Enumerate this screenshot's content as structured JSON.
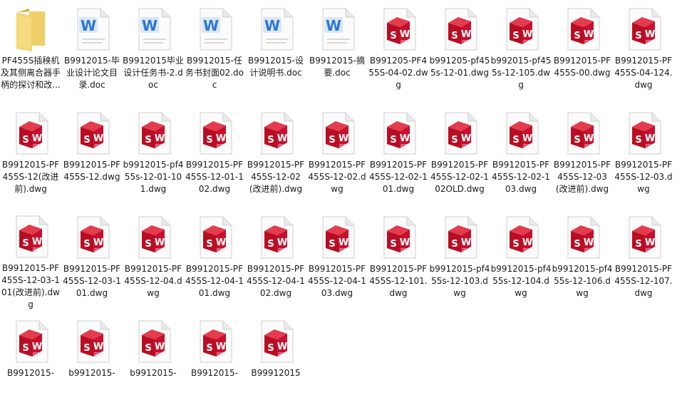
{
  "colors": {
    "folder": "#e8c14f",
    "word_blue": "#2b78d3",
    "sw_red": "#c8102e",
    "doc_page": "#f4f4f4"
  },
  "items": [
    {
      "type": "folder",
      "name": "PF455S插秧机及其侧离合器手柄的探讨和改...",
      "icon": "folder-icon"
    },
    {
      "type": "doc",
      "name": "B9912015-毕业设计论文目录.doc",
      "icon": "word-doc-icon"
    },
    {
      "type": "doc",
      "name": "B9912015毕业设计任务书-2.doc",
      "icon": "word-doc-icon"
    },
    {
      "type": "doc",
      "name": "B9912015-任务书封面02.doc",
      "icon": "word-doc-icon"
    },
    {
      "type": "doc",
      "name": "B9912015-设计说明书.doc",
      "icon": "word-doc-icon"
    },
    {
      "type": "doc",
      "name": "B9912015-摘要.doc",
      "icon": "word-doc-icon"
    },
    {
      "type": "dwg",
      "name": "B991205-PF455S-04-02.dwg",
      "icon": "solidworks-dwg-icon"
    },
    {
      "type": "dwg",
      "name": "b991205-pf455s-12-01.dwg",
      "icon": "solidworks-dwg-icon"
    },
    {
      "type": "dwg",
      "name": "b992015-pf455s-12-105.dwg",
      "icon": "solidworks-dwg-icon"
    },
    {
      "type": "dwg",
      "name": "B9912015-PF455S-00.dwg",
      "icon": "solidworks-dwg-icon"
    },
    {
      "type": "dwg",
      "name": "B9912015-PF455S-04-124.dwg",
      "icon": "solidworks-dwg-icon"
    },
    {
      "type": "dwg",
      "name": "B9912015-PF455S-12(改进前).dwg",
      "icon": "solidworks-dwg-icon"
    },
    {
      "type": "dwg",
      "name": "B9912015-PF455S-12.dwg",
      "icon": "solidworks-dwg-icon"
    },
    {
      "type": "dwg",
      "name": "b9912015-pf455s-12-01-101.dwg",
      "icon": "solidworks-dwg-icon"
    },
    {
      "type": "dwg",
      "name": "B9912015-PF455S-12-01-102.dwg",
      "icon": "solidworks-dwg-icon"
    },
    {
      "type": "dwg",
      "name": "B9912015-PF455S-12-02(改进前).dwg",
      "icon": "solidworks-dwg-icon"
    },
    {
      "type": "dwg",
      "name": "B9912015-PF455S-12-02.dwg",
      "icon": "solidworks-dwg-icon"
    },
    {
      "type": "dwg",
      "name": "B9912015-PF455S-12-02-101.dwg",
      "icon": "solidworks-dwg-icon"
    },
    {
      "type": "dwg",
      "name": "B9912015-PF455S-12-02-102OLD.dwg",
      "icon": "solidworks-dwg-icon"
    },
    {
      "type": "dwg",
      "name": "B9912015-PF455S-12-02-103.dwg",
      "icon": "solidworks-dwg-icon"
    },
    {
      "type": "dwg",
      "name": "B9912015-PF455S-12-03(改进前).dwg",
      "icon": "solidworks-dwg-icon"
    },
    {
      "type": "dwg",
      "name": "B9912015-PF455S-12-03.dwg",
      "icon": "solidworks-dwg-icon"
    },
    {
      "type": "dwg",
      "name": "B9912015-PF455S-12-03-101(改进前).dwg",
      "icon": "solidworks-dwg-icon"
    },
    {
      "type": "dwg",
      "name": "B9912015-PF455S-12-03-101.dwg",
      "icon": "solidworks-dwg-icon"
    },
    {
      "type": "dwg",
      "name": "B9912015-PF455S-12-04.dwg",
      "icon": "solidworks-dwg-icon"
    },
    {
      "type": "dwg",
      "name": "B9912015-PF455S-12-04-101.dwg",
      "icon": "solidworks-dwg-icon"
    },
    {
      "type": "dwg",
      "name": "B9912015-PF455S-12-04-102.dwg",
      "icon": "solidworks-dwg-icon"
    },
    {
      "type": "dwg",
      "name": "B9912015-PF455S-12-04-103.dwg",
      "icon": "solidworks-dwg-icon"
    },
    {
      "type": "dwg",
      "name": "B9912015-PF455S-12-101.dwg",
      "icon": "solidworks-dwg-icon"
    },
    {
      "type": "dwg",
      "name": "b9912015-pf455s-12-103.dwg",
      "icon": "solidworks-dwg-icon"
    },
    {
      "type": "dwg",
      "name": "b9912015-pf455s-12-104.dwg",
      "icon": "solidworks-dwg-icon"
    },
    {
      "type": "dwg",
      "name": "b9912015-pf455s-12-106.dwg",
      "icon": "solidworks-dwg-icon"
    },
    {
      "type": "dwg",
      "name": "B9912015-PF455S-12-107.dwg",
      "icon": "solidworks-dwg-icon"
    },
    {
      "type": "dwg",
      "name": "B9912015-",
      "icon": "solidworks-dwg-icon"
    },
    {
      "type": "dwg",
      "name": "b9912015-",
      "icon": "solidworks-dwg-icon"
    },
    {
      "type": "dwg",
      "name": "b9912015-",
      "icon": "solidworks-dwg-icon"
    },
    {
      "type": "dwg",
      "name": "B9912015-",
      "icon": "solidworks-dwg-icon"
    },
    {
      "type": "dwg",
      "name": "B99912015",
      "icon": "solidworks-dwg-icon"
    }
  ]
}
